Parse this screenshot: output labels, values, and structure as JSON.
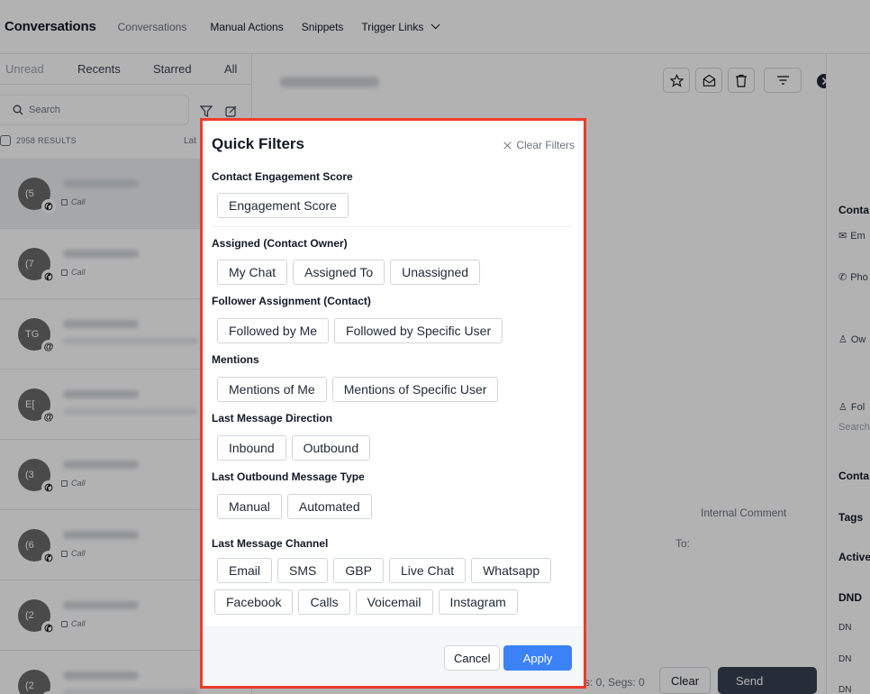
{
  "app": {
    "title": "Conversations",
    "nav": [
      {
        "label": "Conversations"
      },
      {
        "label": "Manual Actions"
      },
      {
        "label": "Snippets"
      },
      {
        "label": "Trigger Links"
      }
    ]
  },
  "left_panel": {
    "tabs": [
      "Unread",
      "Recents",
      "Starred",
      "All"
    ],
    "search_placeholder": "Search",
    "results_count": "2958 RESULTS",
    "sort_label": "Lat",
    "conversations": [
      {
        "avatar": "(5",
        "badge": "call",
        "channel": "Call"
      },
      {
        "avatar": "(7",
        "badge": "call",
        "channel": "Call"
      },
      {
        "avatar": "TG",
        "badge": "@",
        "channel": ""
      },
      {
        "avatar": "E[",
        "badge": "@",
        "channel": ""
      },
      {
        "avatar": "(3",
        "badge": "call",
        "channel": "Call"
      },
      {
        "avatar": "(6",
        "badge": "call",
        "channel": "Call"
      },
      {
        "avatar": "(2",
        "badge": "call",
        "channel": "Call"
      },
      {
        "avatar": "(2",
        "badge": "call",
        "channel": ""
      }
    ]
  },
  "right_panel": {
    "labels": [
      "Conta",
      "Em",
      "Pho",
      "Ow",
      "Fol",
      "Search",
      "Conta",
      "Tags",
      "Active",
      "DND",
      "DN",
      "DN",
      "DN"
    ]
  },
  "composer": {
    "internal_comment": "Internal Comment",
    "to_label": "To:",
    "counts": "s: 0, Segs: 0",
    "clear_label": "Clear",
    "send_label": "Send"
  },
  "modal": {
    "title": "Quick Filters",
    "clear_filters": "Clear Filters",
    "sections": [
      {
        "title": "Contact Engagement Score",
        "chips": [
          "Engagement Score"
        ]
      },
      {
        "title": "Assigned (Contact Owner)",
        "chips": [
          "My Chat",
          "Assigned To",
          "Unassigned"
        ]
      },
      {
        "title": "Follower Assignment (Contact)",
        "chips": [
          "Followed by Me",
          "Followed by Specific User"
        ]
      },
      {
        "title": "Mentions",
        "chips": [
          "Mentions of Me",
          "Mentions of Specific User"
        ]
      },
      {
        "title": "Last Message Direction",
        "chips": [
          "Inbound",
          "Outbound"
        ]
      },
      {
        "title": "Last Outbound Message Type",
        "chips": [
          "Manual",
          "Automated"
        ]
      },
      {
        "title": "Last Message Channel",
        "chips": [
          "Email",
          "SMS",
          "GBP",
          "Live Chat",
          "Whatsapp"
        ],
        "chips_row2": [
          "Facebook",
          "Calls",
          "Voicemail",
          "Instagram"
        ]
      }
    ],
    "cancel_label": "Cancel",
    "apply_label": "Apply"
  },
  "colors": {
    "accent": "#3b82f6",
    "highlight_border": "#ef3b2c",
    "overlay": "rgba(0,0,0,0.30)"
  }
}
